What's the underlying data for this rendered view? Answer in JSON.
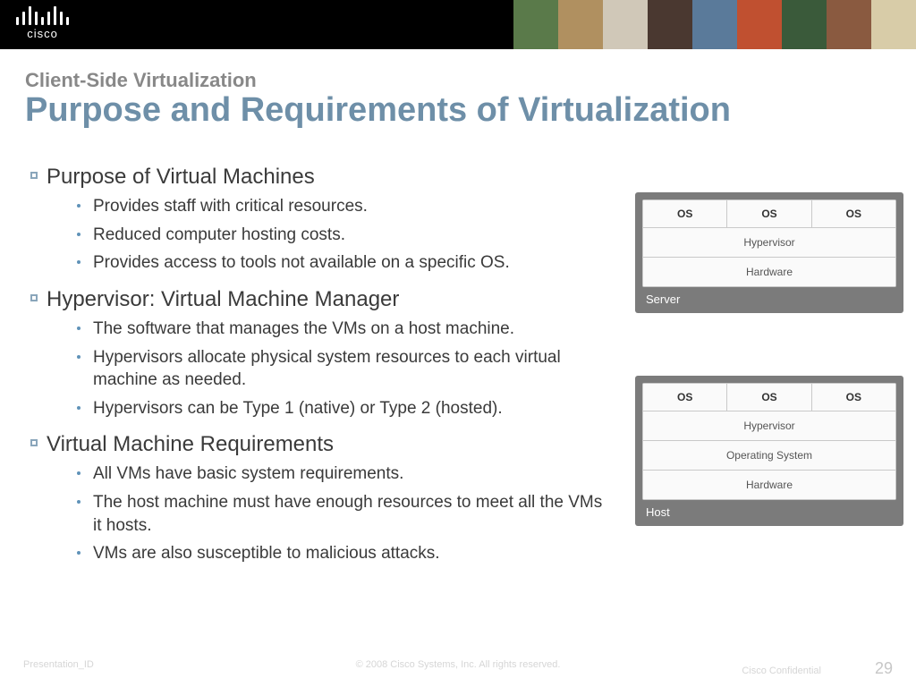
{
  "header": {
    "logo_text": "cisco"
  },
  "subtitle": "Client-Side Virtualization",
  "title": "Purpose and Requirements of Virtualization",
  "sections": [
    {
      "heading": "Purpose of Virtual Machines",
      "items": [
        "Provides staff with critical resources.",
        "Reduced computer hosting costs.",
        "Provides access to tools not available on a specific OS."
      ]
    },
    {
      "heading": "Hypervisor: Virtual Machine Manager",
      "items": [
        "The software that manages the VMs on a host machine.",
        "Hypervisors allocate physical system resources to each virtual machine as needed.",
        "Hypervisors can be Type 1 (native) or Type 2 (hosted)."
      ]
    },
    {
      "heading": "Virtual Machine Requirements",
      "items": [
        "All VMs have basic system requirements.",
        "The host machine must have enough resources to meet all the VMs it hosts.",
        "VMs are also susceptible to malicious attacks."
      ]
    }
  ],
  "diagram_server": {
    "label": "Server",
    "os": "OS",
    "rows": [
      "Hypervisor",
      "Hardware"
    ]
  },
  "diagram_host": {
    "label": "Host",
    "os": "OS",
    "rows": [
      "Hypervisor",
      "Operating System",
      "Hardware"
    ]
  },
  "footer": {
    "left": "Presentation_ID",
    "center": "© 2008 Cisco Systems, Inc. All rights reserved.",
    "right": "Cisco Confidential",
    "page": "29"
  }
}
